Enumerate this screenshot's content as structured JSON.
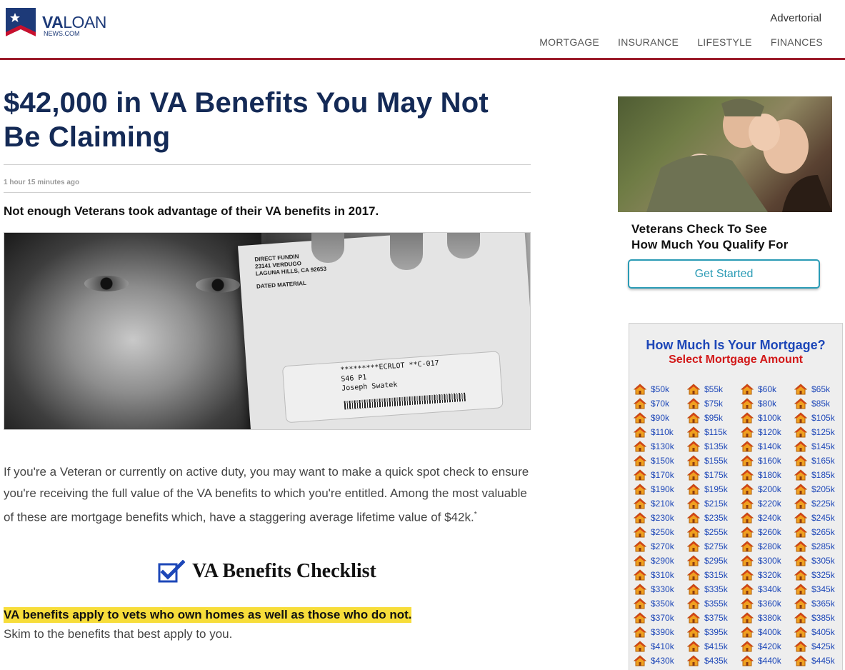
{
  "header": {
    "logo_main_bold": "VA",
    "logo_main_rest": "LOAN",
    "logo_sub": "NEWS.COM",
    "advertorial": "Advertorial",
    "nav": [
      "MORTGAGE",
      "INSURANCE",
      "LIFESTYLE",
      "FINANCES"
    ]
  },
  "article": {
    "headline": "$42,000 in VA Benefits You May Not Be Claiming",
    "timestamp": "1 hour 15 minutes ago",
    "subhead": "Not enough Veterans took advantage of their VA benefits in 2017.",
    "image": {
      "address_lines": [
        "DIRECT FUNDIN",
        "23141 VERDUGO",
        "LAGUNA HILLS, CA 92653"
      ],
      "dated_material": "DATED MATERIAL",
      "check_lines": [
        "*********ECRLOT **C-017",
        "S46 P1",
        "Joseph Swatek"
      ]
    },
    "body_pre": "If you're a Veteran or currently on active duty, you may want to make a quick spot check to ensure you're receiving the full value of the VA benefits to which you're entitled. Among the most valuable of these are mortgage benefits which, have a staggering average lifetime value of $42k.",
    "body_sup": "*",
    "checklist_title": "VA Benefits Checklist",
    "highlight": "VA benefits apply to vets who own homes as well as those who do not.",
    "skim": "Skim to the benefits that best apply to you."
  },
  "sidebar": {
    "caption_line1": "Veterans Check To See",
    "caption_line2": "How Much You Qualify For",
    "cta": "Get Started",
    "widget": {
      "title": "How Much Is Your Mortgage?",
      "subtitle": "Select Mortgage Amount",
      "amounts": [
        "$50k",
        "$55k",
        "$60k",
        "$65k",
        "$70k",
        "$75k",
        "$80k",
        "$85k",
        "$90k",
        "$95k",
        "$100k",
        "$105k",
        "$110k",
        "$115k",
        "$120k",
        "$125k",
        "$130k",
        "$135k",
        "$140k",
        "$145k",
        "$150k",
        "$155k",
        "$160k",
        "$165k",
        "$170k",
        "$175k",
        "$180k",
        "$185k",
        "$190k",
        "$195k",
        "$200k",
        "$205k",
        "$210k",
        "$215k",
        "$220k",
        "$225k",
        "$230k",
        "$235k",
        "$240k",
        "$245k",
        "$250k",
        "$255k",
        "$260k",
        "$265k",
        "$270k",
        "$275k",
        "$280k",
        "$285k",
        "$290k",
        "$295k",
        "$300k",
        "$305k",
        "$310k",
        "$315k",
        "$320k",
        "$325k",
        "$330k",
        "$335k",
        "$340k",
        "$345k",
        "$350k",
        "$355k",
        "$360k",
        "$365k",
        "$370k",
        "$375k",
        "$380k",
        "$385k",
        "$390k",
        "$395k",
        "$400k",
        "$405k",
        "$410k",
        "$415k",
        "$420k",
        "$425k",
        "$430k",
        "$435k",
        "$440k",
        "$445k"
      ]
    }
  },
  "colors": {
    "brand_navy": "#142a56",
    "header_rule": "#9b1b2a",
    "cta_teal": "#2a9bb5",
    "widget_blue": "#1d47b8",
    "widget_red": "#d21818",
    "highlight_yellow": "#f7dd3a"
  }
}
